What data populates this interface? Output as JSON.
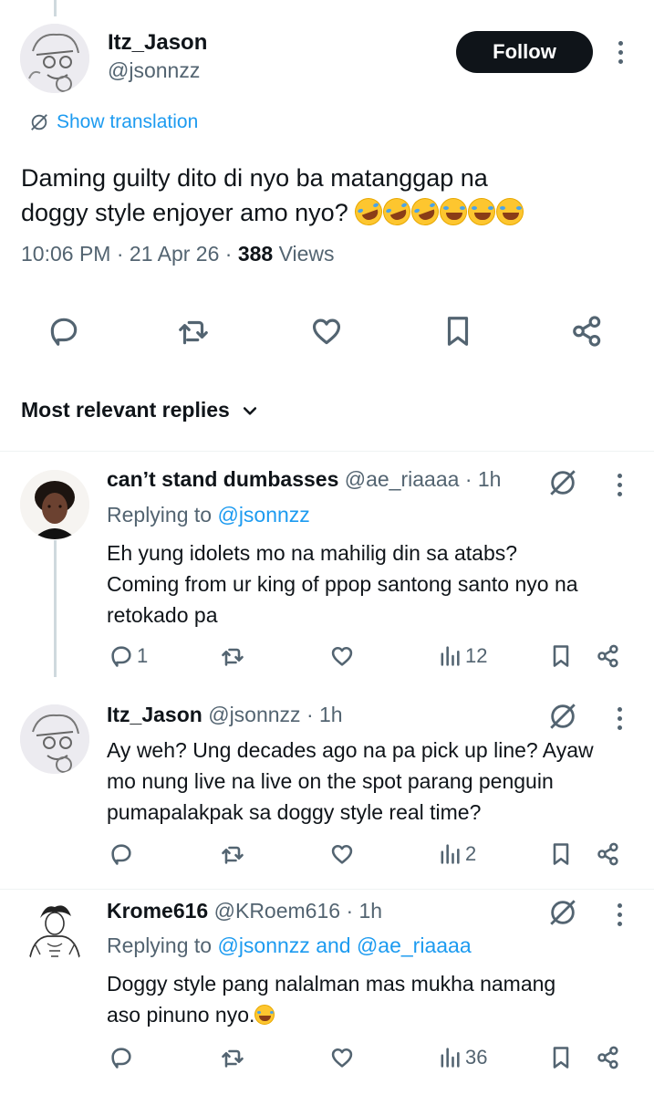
{
  "main_tweet": {
    "author_name": "Itz_Jason",
    "handle": "@jsonnzz",
    "follow_label": "Follow",
    "translate_label": "Show translation",
    "text_line1": "Daming guilty dito di nyo ba matanggap na",
    "text_line2": "doggy style enjoyer amo nyo?",
    "emojis": [
      "rolling-on-floor-laughing",
      "rolling-on-floor-laughing",
      "rolling-on-floor-laughing",
      "face-with-tears-of-joy",
      "face-with-tears-of-joy",
      "face-with-tears-of-joy"
    ],
    "time": "10:06 PM",
    "date": "21 Apr 26",
    "separator": "·",
    "views_count": "388",
    "views_label": "Views",
    "actions": [
      "reply-icon",
      "retweet-icon",
      "like-icon",
      "bookmark-icon",
      "share-icon"
    ]
  },
  "replies_sort": {
    "label": "Most relevant replies"
  },
  "replies": [
    {
      "name": "can’t stand dumbasses",
      "handle": "@ae_riaaaa",
      "age": "· 1h",
      "replying_prefix": "Replying to",
      "replying_to": "@jsonnzz",
      "line1": "Eh yung idolets mo na mahilig din sa atabs?",
      "line2": "Coming from ur king of ppop santong santo nyo na",
      "line3": "retokado pa",
      "reply_count": "1",
      "view_count": "12"
    },
    {
      "name": "Itz_Jason",
      "handle": "@jsonnzz",
      "age": "· 1h",
      "line1": "Ay weh? Ung decades ago na pa pick up line? Ayaw",
      "line2": "mo nung live na live on the spot parang penguin",
      "line3": "pumapalakpak sa doggy style real time?",
      "view_count": "2"
    },
    {
      "name": "Krome616",
      "handle": "@KRoem616",
      "age": "· 1h",
      "replying_prefix": "Replying to",
      "replying_to": "@jsonnzz and @ae_riaaaa",
      "line1": "Doggy style pang nalalman mas mukha namang",
      "line2": "aso pinuno nyo.",
      "view_count": "36"
    }
  ],
  "colors": {
    "accent": "#1d9bf0",
    "text": "#0f1419",
    "muted": "#536471",
    "follow_bg": "#0f1419",
    "thread_line": "#cfd9de"
  }
}
